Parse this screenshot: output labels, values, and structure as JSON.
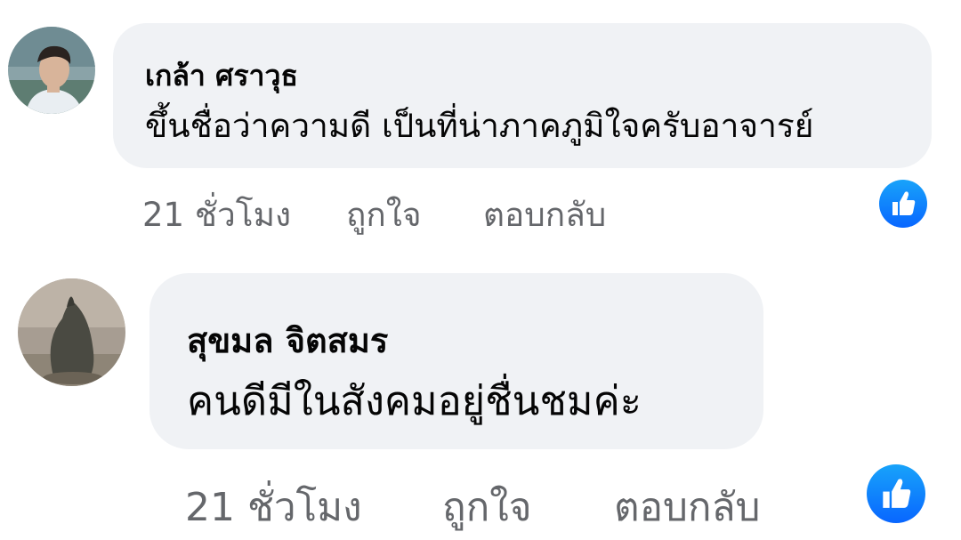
{
  "comments": [
    {
      "author": "เกล้า ศราวุธ",
      "text": "ขึ้นชื่อว่าความดี เป็นที่น่าภาคภูมิใจครับอาจารย์",
      "time": "21 ชั่วโมง",
      "like_label": "ถูกใจ",
      "reply_label": "ตอบกลับ",
      "reaction_icon": "like-icon"
    },
    {
      "author": "สุขมล จิตสมร",
      "text": "คนดีมีในสังคมอยู่ชื่นชมค่ะ",
      "time": "21 ชั่วโมง",
      "like_label": "ถูกใจ",
      "reply_label": "ตอบกลับ",
      "reaction_icon": "like-icon"
    }
  ],
  "colors": {
    "bubble": "#f0f2f5",
    "text": "#050505",
    "meta": "#65676b",
    "like_blue": "#0866ff"
  }
}
